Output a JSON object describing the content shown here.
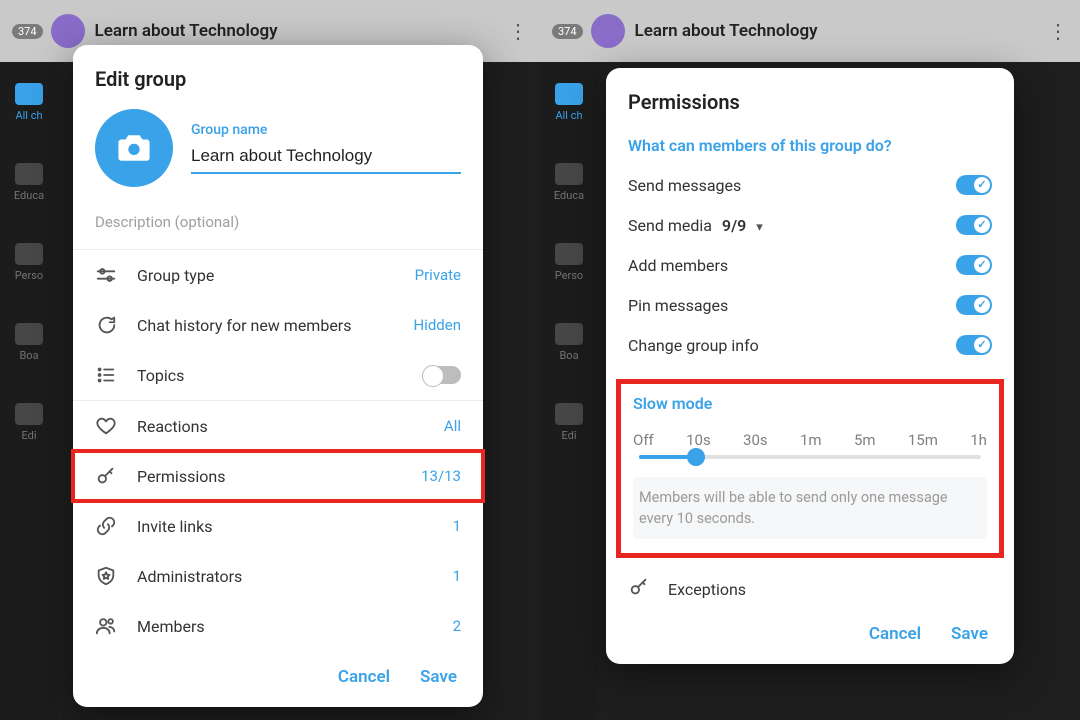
{
  "background": {
    "chat_badge": "374",
    "chat_title": "Learn about Technology",
    "sidebar": [
      "All ch",
      "Educa",
      "Perso",
      "Boa",
      "Edi"
    ]
  },
  "left_modal": {
    "title": "Edit group",
    "group_name_label": "Group name",
    "group_name_value": "Learn about Technology",
    "description_placeholder": "Description (optional)",
    "items": {
      "group_type": {
        "label": "Group type",
        "value": "Private"
      },
      "chat_history": {
        "label": "Chat history for new members",
        "value": "Hidden"
      },
      "topics": {
        "label": "Topics"
      },
      "reactions": {
        "label": "Reactions",
        "value": "All"
      },
      "permissions": {
        "label": "Permissions",
        "value": "13/13"
      },
      "invite_links": {
        "label": "Invite links",
        "value": "1"
      },
      "administrators": {
        "label": "Administrators",
        "value": "1"
      },
      "members": {
        "label": "Members",
        "value": "2"
      }
    },
    "cancel": "Cancel",
    "save": "Save"
  },
  "right_modal": {
    "title": "Permissions",
    "question": "What can members of this group do?",
    "perms": {
      "send_messages": "Send messages",
      "send_media": "Send media",
      "send_media_count": "9/9",
      "add_members": "Add members",
      "pin_messages": "Pin messages",
      "change_info": "Change group info"
    },
    "slow_mode": {
      "title": "Slow mode",
      "options": [
        "Off",
        "10s",
        "30s",
        "1m",
        "5m",
        "15m",
        "1h"
      ],
      "note": "Members will be able to send only one message every 10 seconds."
    },
    "exceptions": "Exceptions",
    "cancel": "Cancel",
    "save": "Save"
  }
}
